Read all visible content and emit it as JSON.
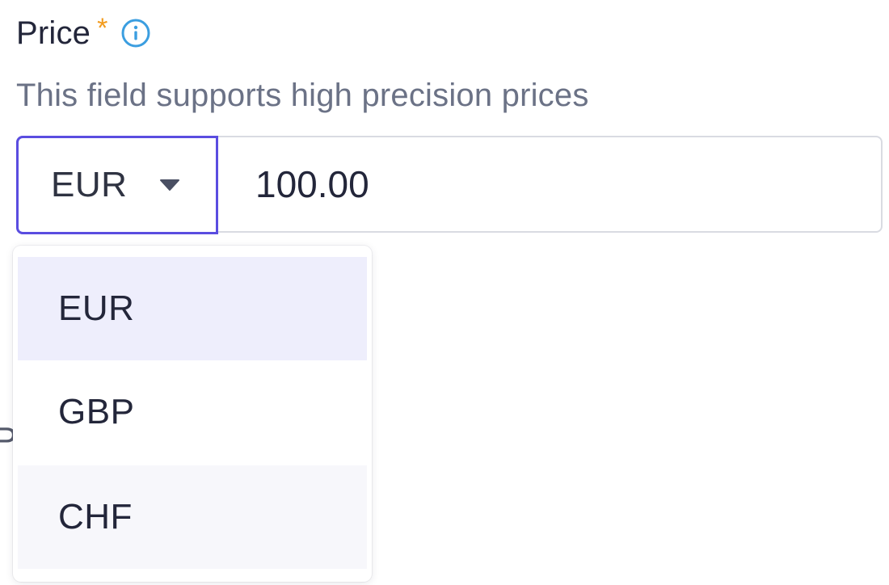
{
  "field": {
    "label": "Price",
    "required_marker": "*",
    "info_icon": "info-circle-icon",
    "help_text": "This field supports high precision prices"
  },
  "currency_select": {
    "selected_value": "EUR",
    "caret_icon": "caret-down-icon",
    "options": [
      "EUR",
      "GBP",
      "CHF"
    ],
    "highlighted_option": "EUR"
  },
  "amount_input": {
    "value": "100.00"
  },
  "background_text": {
    "partial_label": "P"
  },
  "colors": {
    "accent": "#5a4de0",
    "required": "#f29b1d",
    "info": "#3b9ee0",
    "highlight": "#eeeefc"
  }
}
